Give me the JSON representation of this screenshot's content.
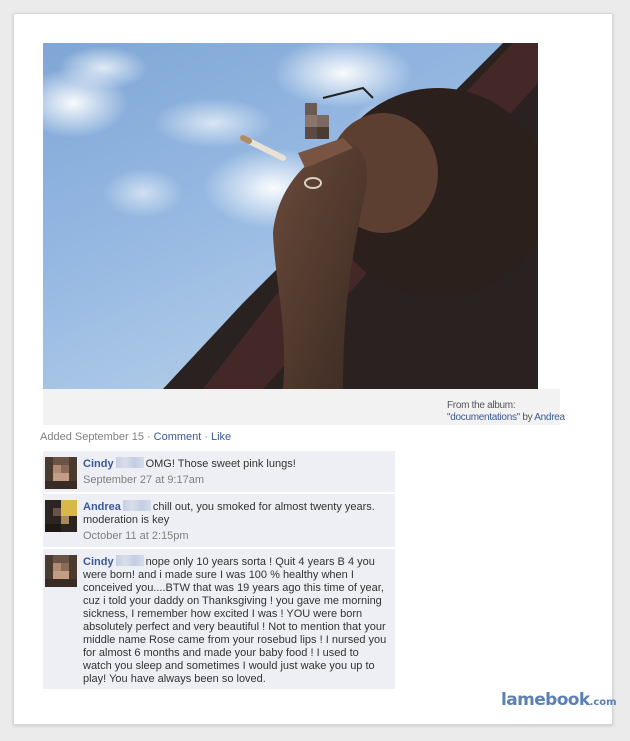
{
  "photo": {
    "alt": ""
  },
  "album": {
    "from_label": "From the album:",
    "album_name": "\"documentations\"",
    "by_label": "by",
    "owner": "Andrea"
  },
  "post_meta": {
    "added": "Added September 15",
    "comment_label": "Comment",
    "like_label": "Like",
    "separator": "·"
  },
  "comments": [
    {
      "author": "Cindy",
      "text": "OMG! Those sweet pink lungs!",
      "time": "September 27 at 9:17am"
    },
    {
      "author": "Andrea",
      "text": "chill out, you smoked for almost twenty years. moderation is key",
      "time": "October 11 at 2:15pm"
    },
    {
      "author": "Cindy",
      "text": "nope only 10 years sorta ! Quit 4 years B 4 you were born! and i made sure I was 100 % healthy when I conceived you....BTW that was 19 years ago this time of year, cuz i told your daddy on Thanksgiving ! you gave me morning sickness, I remember how excited I was ! YOU were born absolutely perfect and very beautiful ! Not to mention that your middle name Rose came from your rosebud lips ! I nursed you for almost 6 months and made your baby food ! I used to watch you sleep and sometimes I would just wake you up to play! You have always been so loved.",
      "time": ""
    }
  ],
  "brand": {
    "name": "lamebook",
    "tld": ".com",
    "color": "#5b80b5"
  },
  "colors": {
    "link": "#3b5998",
    "comment_bg": "#edeff4",
    "meta": "#808080"
  }
}
